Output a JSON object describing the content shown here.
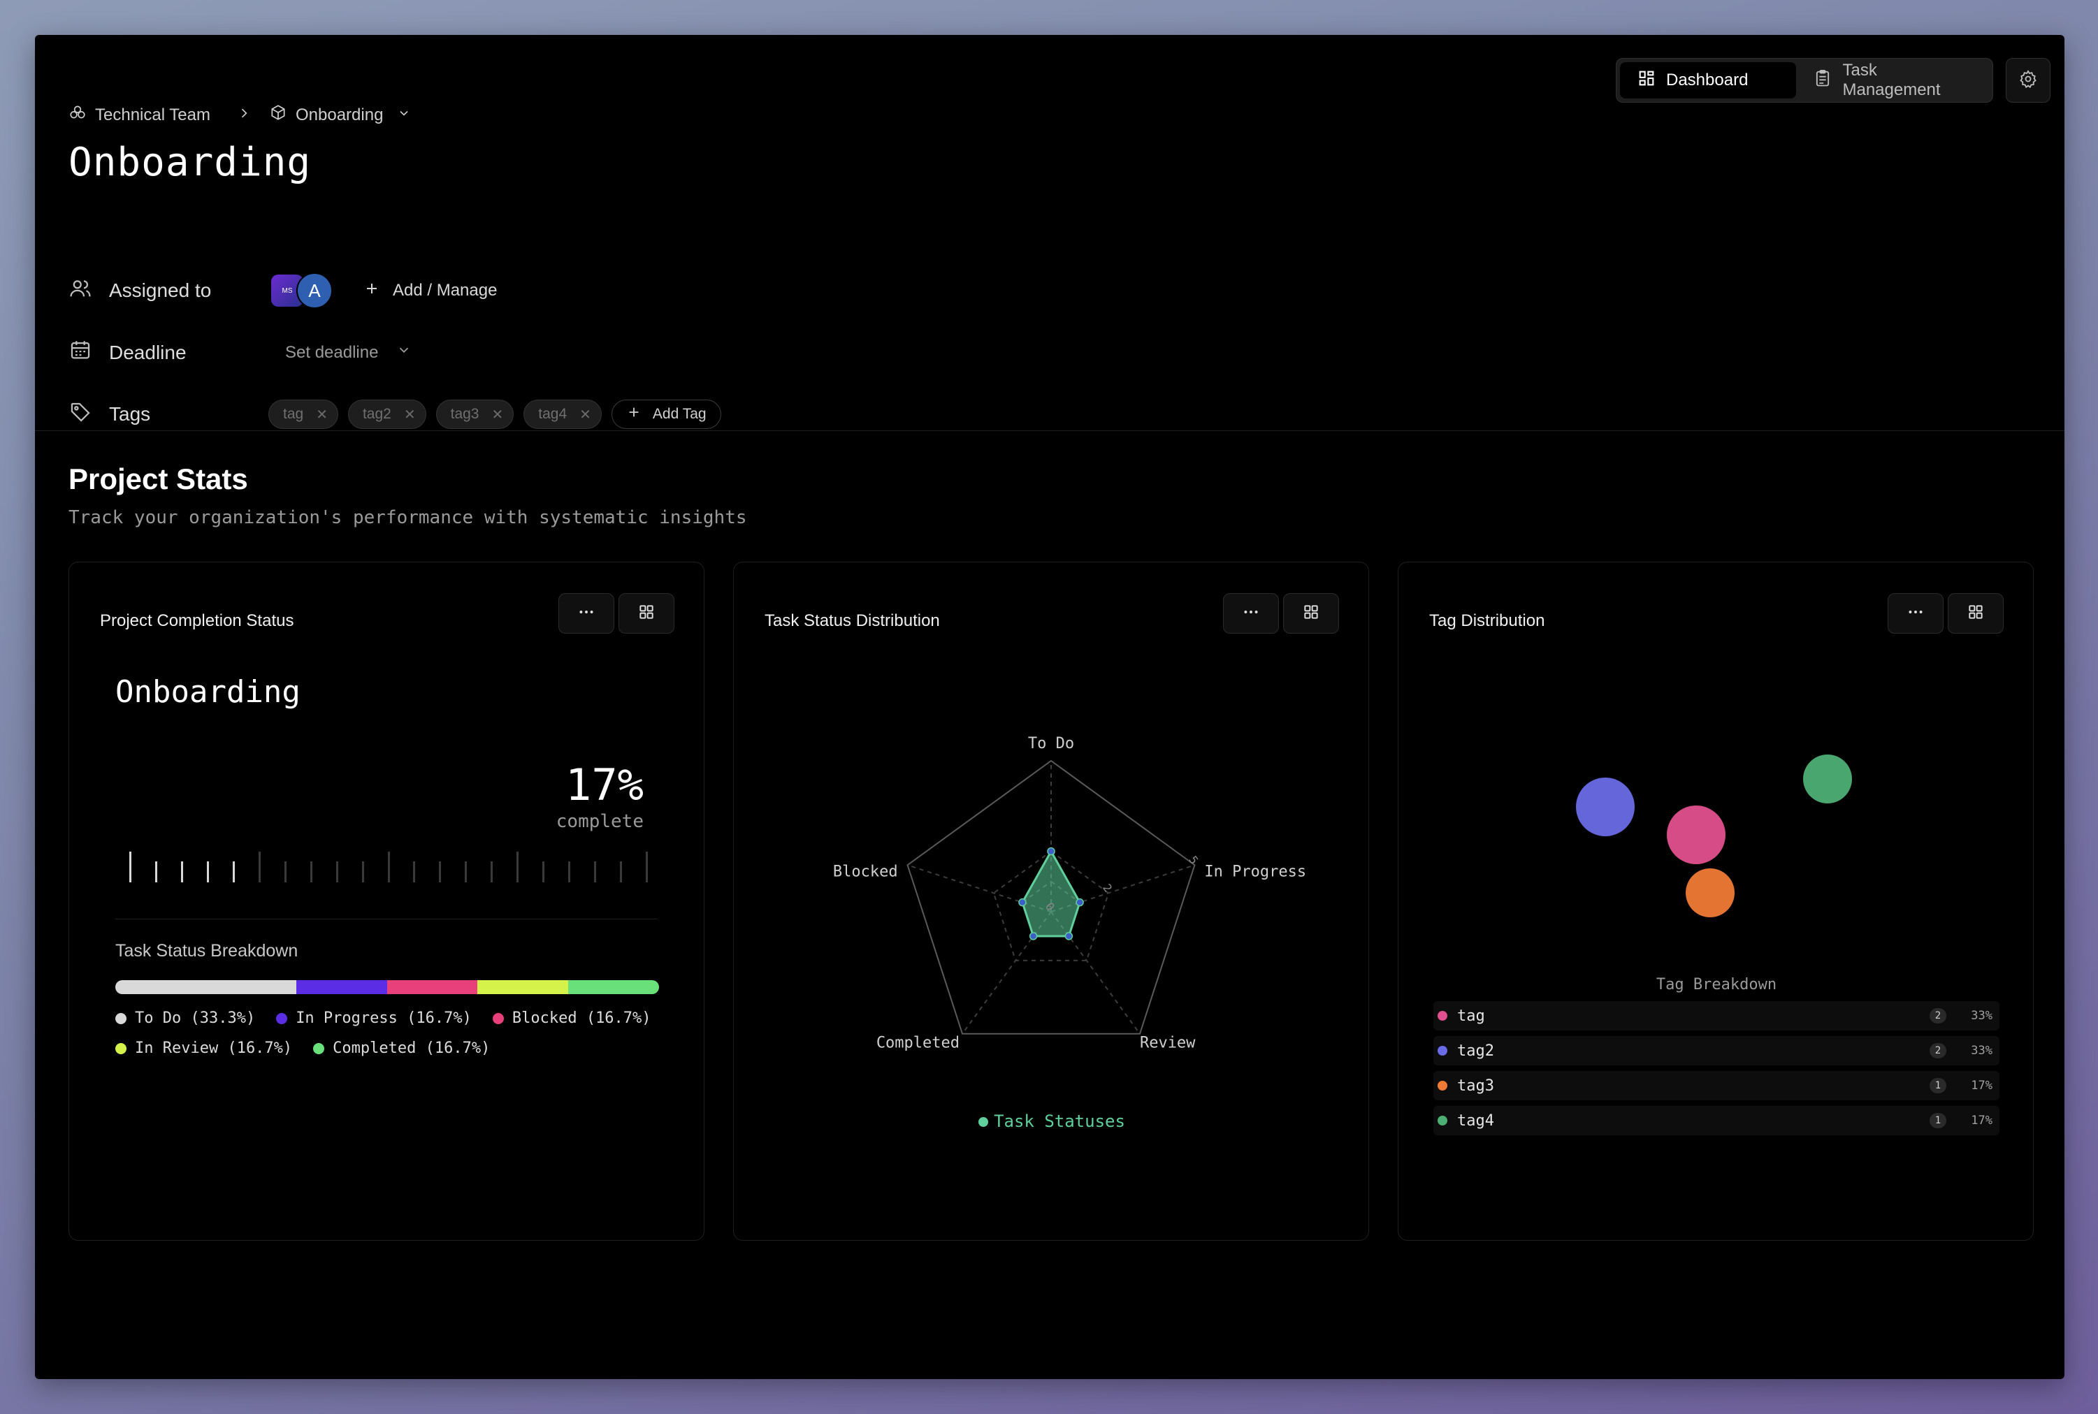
{
  "breadcrumb": {
    "team": "Technical Team",
    "project": "Onboarding"
  },
  "view_switch": {
    "dashboard": "Dashboard",
    "task_management": "Task Management"
  },
  "page": {
    "title": "Onboarding"
  },
  "properties": {
    "assigned_label": "Assigned to",
    "avatar_initial": "A",
    "add_manage": "Add / Manage",
    "deadline_label": "Deadline",
    "deadline_value": "Set deadline",
    "tags_label": "Tags",
    "tags": [
      "tag",
      "tag2",
      "tag3",
      "tag4"
    ],
    "add_tag": "Add Tag"
  },
  "stats": {
    "title": "Project Stats",
    "subtitle": "Track your organization's performance with systematic insights"
  },
  "cards": {
    "completion": {
      "title": "Project Completion Status",
      "project_name": "Onboarding",
      "percent": "17%",
      "percent_value": 17,
      "complete_label": "complete",
      "breakdown_title": "Task Status Breakdown",
      "segments": [
        {
          "label": "To Do (33.3%)",
          "value": 33.3,
          "color": "#d9d9d9"
        },
        {
          "label": "In Progress (16.7%)",
          "value": 16.7,
          "color": "#5b2ee6"
        },
        {
          "label": "Blocked (16.7%)",
          "value": 16.7,
          "color": "#e8407a"
        },
        {
          "label": "In Review (16.7%)",
          "value": 16.7,
          "color": "#d4f24a"
        },
        {
          "label": "Completed (16.7%)",
          "value": 16.7,
          "color": "#6ae07a"
        }
      ]
    },
    "task_status": {
      "title": "Task Status Distribution",
      "legend": "Task Statuses",
      "series_color": "#5fcf9c"
    },
    "tags": {
      "title": "Tag Distribution",
      "breakdown_title": "Tag Breakdown",
      "items": [
        {
          "name": "tag",
          "count": "2",
          "pct": "33%",
          "color": "#e0508e"
        },
        {
          "name": "tag2",
          "count": "2",
          "pct": "33%",
          "color": "#6a6be6"
        },
        {
          "name": "tag3",
          "count": "1",
          "pct": "17%",
          "color": "#ef7a35"
        },
        {
          "name": "tag4",
          "count": "1",
          "pct": "17%",
          "color": "#4caf74"
        }
      ]
    }
  },
  "chart_data": [
    {
      "type": "radar",
      "axes": [
        "To Do",
        "In Progress",
        "Review",
        "Completed",
        "Blocked"
      ],
      "tick_labels": [
        "0",
        "2",
        "5"
      ],
      "series": [
        {
          "name": "Task Statuses",
          "values": [
            2,
            1,
            1,
            1,
            1
          ]
        }
      ],
      "range": [
        0,
        5
      ]
    },
    {
      "type": "scatter",
      "categories": [
        "tag",
        "tag2",
        "tag3",
        "tag4"
      ],
      "values": [
        2,
        2,
        1,
        1
      ]
    }
  ]
}
